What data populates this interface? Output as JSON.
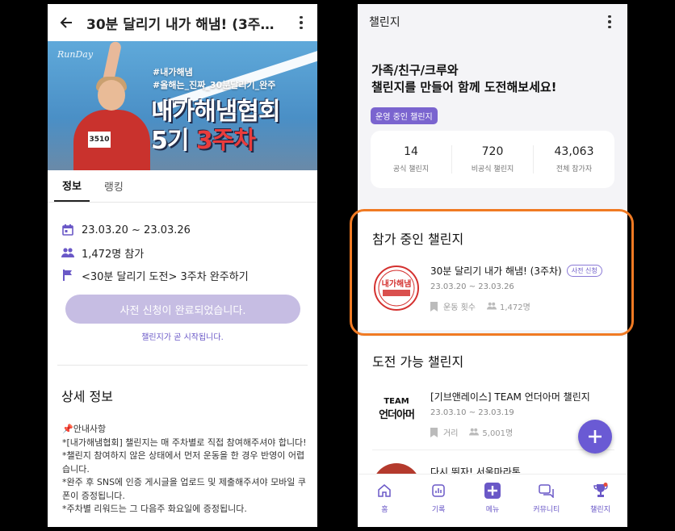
{
  "left": {
    "title": "30분 달리기 내가 해냄! (3주…",
    "banner": {
      "brand": "RunDay",
      "tag1": "#내가해냄",
      "tag2": "#올해는_진짜_30분달리기_완주",
      "headline1": "내가해냄협회",
      "headline2_a": "5기 ",
      "headline2_b": "3주차",
      "bib": "3510"
    },
    "tabs": [
      "정보",
      "랭킹"
    ],
    "period": "23.03.20 ~ 23.03.26",
    "participants": "1,472명 참가",
    "goal": "<30분 달리기 도전> 3주차 완주하기",
    "button": "사전 신청이 완료되었습니다.",
    "soon": "챌린지가 곧 시작됩니다.",
    "detail_title": "상세 정보",
    "detail_body": "📌안내사항\n*[내가해냄협회] 챌린지는 매 주차별로 직접 참여해주셔야 합니다!\n*챌린지 참여하지 않은 상태에서 먼저 운동을 한 경우 반영이 어렵습니다.\n*완주 후 SNS에 인증 게시글을 업로드 및 제출해주셔야 모바일 쿠폰이 증정됩니다.\n*주차별 리워드는 그 다음주 화요일에 증정됩니다."
  },
  "right": {
    "title": "챌린지",
    "hero": "가족/친구/크루와\n챌린지를 만들어 함께 도전해보세요!",
    "pill": "운영 중인 챌린지",
    "stats": [
      {
        "num": "14",
        "label": "공식 챌린지"
      },
      {
        "num": "720",
        "label": "비공식 챌린지"
      },
      {
        "num": "43,063",
        "label": "전체 참가자"
      }
    ],
    "joined_title": "참가 중인 챌린지",
    "joined": {
      "name": "30분 달리기 내가 해냄! (3주차)",
      "badge": "사전 신청",
      "date": "23.03.20 ~ 23.03.26",
      "type": "운동 횟수",
      "count": "1,472명",
      "stamp": "내가해냄"
    },
    "available_title": "도전 가능 챌린지",
    "available": [
      {
        "name": "[기브앤레이스] TEAM 언더아머 챌린지",
        "date": "23.03.10 ~ 23.03.19",
        "type": "거리",
        "count": "5,001명",
        "logo1": "TEAM",
        "logo2": "언더아머"
      },
      {
        "name": "다시 뛰자! 서울마라톤"
      }
    ],
    "nav": [
      "홈",
      "기록",
      "메뉴",
      "커뮤니티",
      "챌린지"
    ],
    "colors": {
      "accent": "#6a5ad4",
      "highlight": "#f07a23"
    }
  }
}
